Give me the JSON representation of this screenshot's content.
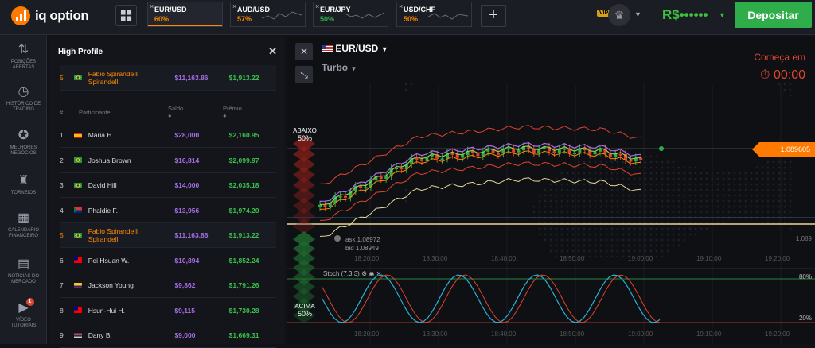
{
  "app": {
    "logo_text": "iq option"
  },
  "tabs": [
    {
      "pair": "EUR/USD",
      "pct": "60%",
      "active": true
    },
    {
      "pair": "AUD/USD",
      "pct": "57%",
      "active": false
    },
    {
      "pair": "EUR/JPY",
      "pct": "50%",
      "active": false
    },
    {
      "pair": "USD/CHF",
      "pct": "50%",
      "active": false
    }
  ],
  "header": {
    "vip": "VIP",
    "balance": "R$••••••",
    "deposit": "Depositar"
  },
  "sidebar": [
    {
      "label1": "POSIÇÕES",
      "label2": "ABERTAS",
      "icon": "swap-arrows-icon"
    },
    {
      "label1": "HISTÓRICO DE",
      "label2": "TRADING",
      "icon": "history-icon"
    },
    {
      "label1": "MELHORES",
      "label2": "NEGÓCIOS",
      "icon": "medal-icon"
    },
    {
      "label1": "TORNEIOS",
      "label2": "",
      "icon": "trophy-icon"
    },
    {
      "label1": "CALENDÁRIO",
      "label2": "FINANCEIRO",
      "icon": "calendar-icon"
    },
    {
      "label1": "NOTÍCIAS DO",
      "label2": "MERCADO",
      "icon": "news-icon"
    },
    {
      "label1": "VÍDEO",
      "label2": "TUTORIAIS",
      "icon": "video-icon"
    }
  ],
  "panel": {
    "title": "High Profile",
    "highlight": {
      "rank": "5",
      "name1": "Fabio Spirandelli",
      "name2": "Spirandelli",
      "saldo": "$11,163.86",
      "premio": "$1,913.22",
      "flag": "br"
    },
    "headers": {
      "rank": "#",
      "participant": "Participante",
      "saldo": "Saldo",
      "premio": "Prêmio"
    },
    "rows": [
      {
        "rank": "1",
        "name1": "Maria H.",
        "name2": "",
        "saldo": "$28,000",
        "premio": "$2,160.95",
        "flag": "es"
      },
      {
        "rank": "2",
        "name1": "Joshua Brown",
        "name2": "",
        "saldo": "$16,814",
        "premio": "$2,099.97",
        "flag": "br"
      },
      {
        "rank": "3",
        "name1": "David Hill",
        "name2": "",
        "saldo": "$14,000",
        "premio": "$2,035.18",
        "flag": "br"
      },
      {
        "rank": "4",
        "name1": "Phaldie F.",
        "name2": "",
        "saldo": "$13,956",
        "premio": "$1,974.20",
        "flag": "za"
      },
      {
        "rank": "5",
        "name1": "Fabio Spirandelli",
        "name2": "Spirandelli",
        "saldo": "$11,163.86",
        "premio": "$1,913.22",
        "flag": "br",
        "hl": true
      },
      {
        "rank": "6",
        "name1": "Pei Hsuan W.",
        "name2": "",
        "saldo": "$10,894",
        "premio": "$1,852.24",
        "flag": "tw"
      },
      {
        "rank": "7",
        "name1": "Jackson Young",
        "name2": "",
        "saldo": "$9,862",
        "premio": "$1,791.26",
        "flag": "co"
      },
      {
        "rank": "8",
        "name1": "Hsun-Hui H.",
        "name2": "",
        "saldo": "$9,115",
        "premio": "$1,730.28",
        "flag": "tw"
      },
      {
        "rank": "9",
        "name1": "Dany B.",
        "name2": "",
        "saldo": "$9,000",
        "premio": "$1,669.31",
        "flag": "th"
      }
    ]
  },
  "chart": {
    "asset": "EUR/USD",
    "mode": "Turbo",
    "starts_label": "Começa em",
    "timer": "00:00",
    "price": "1.089605",
    "ask": "ask 1.08972",
    "bid": "bid 1.08949",
    "right_price": "1.089",
    "down_label": "ABAIXO",
    "down_pct": "50%",
    "up_label": "ACIMA",
    "up_pct": "50%",
    "stoch_label": "Stoch (7,3,3)",
    "stoch_80": "80%",
    "stoch_20": "20%",
    "times": [
      "18:20:00",
      "18:30:00",
      "18:40:00",
      "18:50:00",
      "19:00:00",
      "19:10:00",
      "19:20:00"
    ],
    "colors": {
      "accent": "#ff7a00",
      "green": "#2fad4a",
      "red": "#e0442c",
      "purple": "#a86fe8"
    }
  }
}
